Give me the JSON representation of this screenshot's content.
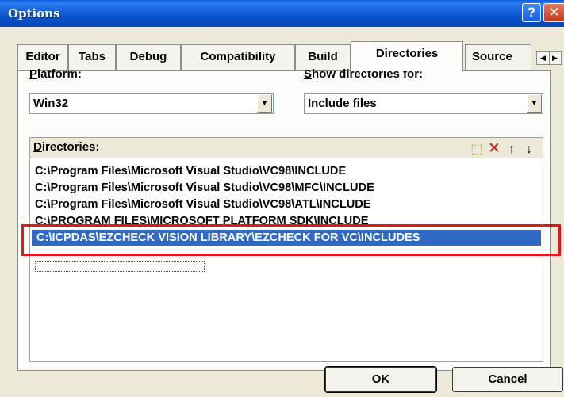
{
  "window": {
    "title": "Options",
    "help_glyph": "?",
    "close_glyph": "✕"
  },
  "tabs": [
    {
      "label": "Editor",
      "active": false
    },
    {
      "label": "Tabs",
      "active": false
    },
    {
      "label": "Debug",
      "active": false
    },
    {
      "label": "Compatibility",
      "active": false
    },
    {
      "label": "Build",
      "active": false
    },
    {
      "label": "Directories",
      "active": true
    },
    {
      "label": "Source",
      "active": false
    }
  ],
  "tab_scroll": {
    "left": "◀",
    "right": "▶"
  },
  "platform": {
    "label_key": "P",
    "label_rest": "latform:",
    "value": "Win32"
  },
  "show_dirs": {
    "label_key": "S",
    "label_rest": "how directories for:",
    "value": "Include files"
  },
  "dropdown_arrow": "▼",
  "directories": {
    "label_key": "D",
    "label_rest": "irectories:",
    "tools": {
      "new": "⬚",
      "delete": "✕",
      "up": "↑",
      "down": "↓"
    },
    "items": [
      "C:\\Program Files\\Microsoft Visual Studio\\VC98\\INCLUDE",
      "C:\\Program Files\\Microsoft Visual Studio\\VC98\\MFC\\INCLUDE",
      "C:\\Program Files\\Microsoft Visual Studio\\VC98\\ATL\\INCLUDE",
      "C:\\PROGRAM FILES\\MICROSOFT PLATFORM SDK\\INCLUDE",
      "C:\\ICPDAS\\EZCHECK VISION LIBRARY\\EZCHECK FOR VC\\INCLUDES"
    ],
    "selected_index": 4
  },
  "buttons": {
    "ok": "OK",
    "cancel": "Cancel"
  },
  "colors": {
    "title_bar": "#0b57d0",
    "selection": "#316ac5",
    "highlight_box": "#e3161c"
  }
}
